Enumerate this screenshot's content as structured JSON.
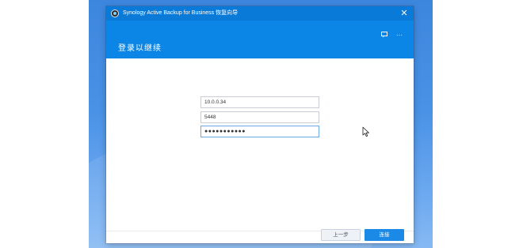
{
  "window": {
    "title": "Synology Active Backup for Business 恢复向导",
    "close_glyph": "✕"
  },
  "header": {
    "title": "登录以继续",
    "feedback_icon": "feedback-icon",
    "more_glyph": "···"
  },
  "form": {
    "server_value": "10.0.0.34",
    "port_value": "5448",
    "password_value": "●●●●●●●●●●●"
  },
  "footer": {
    "prev_label": "上一步",
    "next_label": "连接"
  },
  "colors": {
    "titlebar": "#0a7ad8",
    "header": "#0b86e6",
    "primary_button": "#1a8ae6"
  }
}
